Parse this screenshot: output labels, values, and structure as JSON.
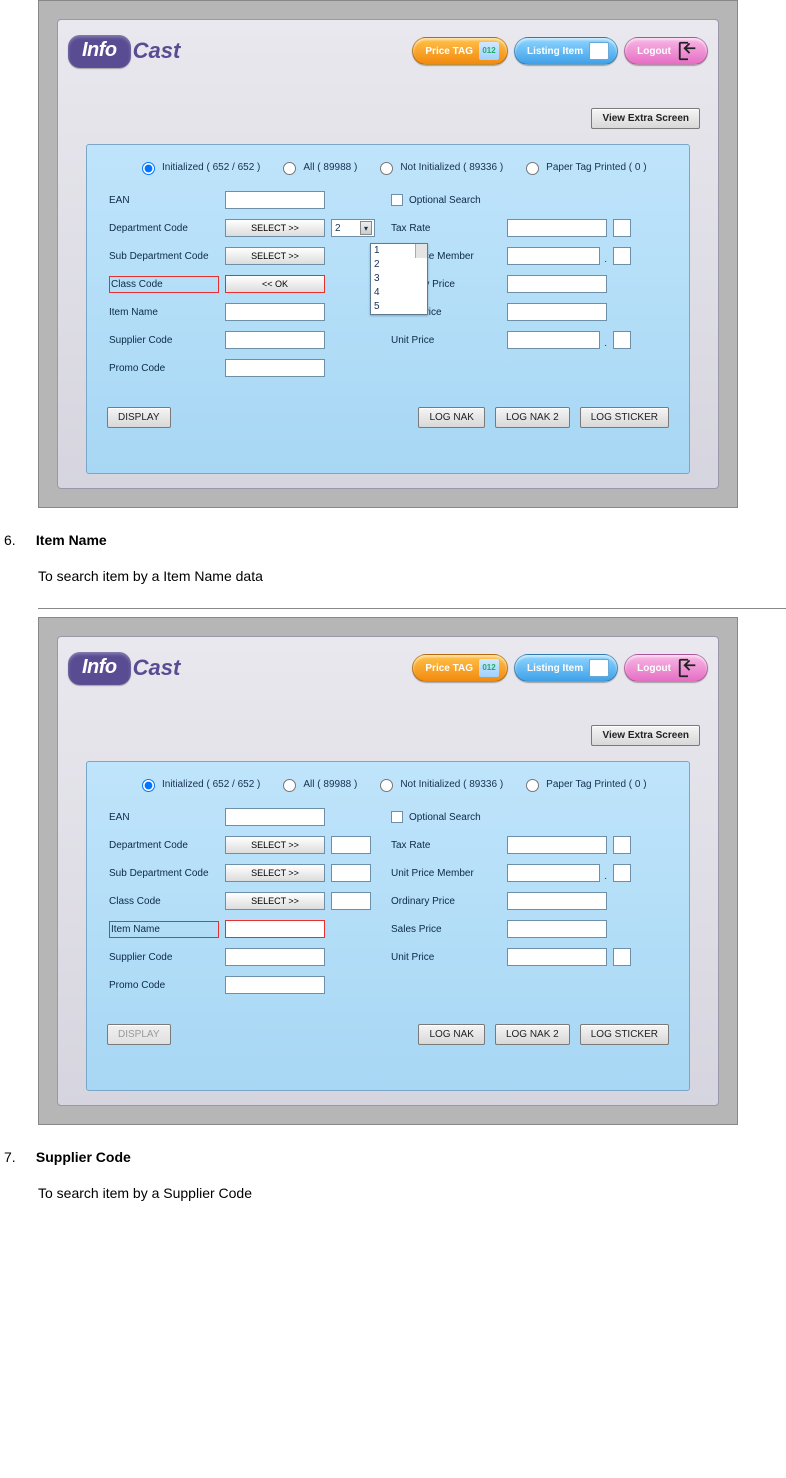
{
  "logo": {
    "bubble": "Info",
    "text": "Cast"
  },
  "pills": {
    "price": "Price TAG",
    "price_code": "012",
    "listing": "Listing Item",
    "logout": "Logout"
  },
  "btn": {
    "view_extra": "View Extra Screen",
    "display": "DISPLAY",
    "log_nak": "LOG NAK",
    "log_nak2": "LOG NAK 2",
    "log_sticker": "LOG STICKER",
    "select": "SELECT >>",
    "ok": "<< OK"
  },
  "radios": {
    "initialized": "Initialized  ( 652 / 652 )",
    "all": "All  ( 89988 )",
    "not_init": "Not Initialized  ( 89336 )",
    "paper": "Paper Tag Printed  ( 0 )"
  },
  "labels": {
    "ean": "EAN",
    "dept": "Department Code",
    "subdept": "Sub Department Code",
    "class": "Class Code",
    "item": "Item Name",
    "supplier": "Supplier Code",
    "promo": "Promo Code",
    "optsearch": "Optional Search",
    "tax": "Tax Rate",
    "upm": "Unit Price Member",
    "ord": "Ordinary Price",
    "sales": "Sales Price",
    "unit": "Unit Price"
  },
  "dropdown": {
    "dept_selected": "2",
    "options": [
      "1",
      "2",
      "3",
      "4",
      "5"
    ]
  },
  "sections": {
    "six_num": "6.",
    "six_title": "Item Name",
    "six_text": "To search item by a Item Name data",
    "seven_num": "7.",
    "seven_title": "Supplier Code",
    "seven_text": "To search item by a Supplier Code"
  }
}
